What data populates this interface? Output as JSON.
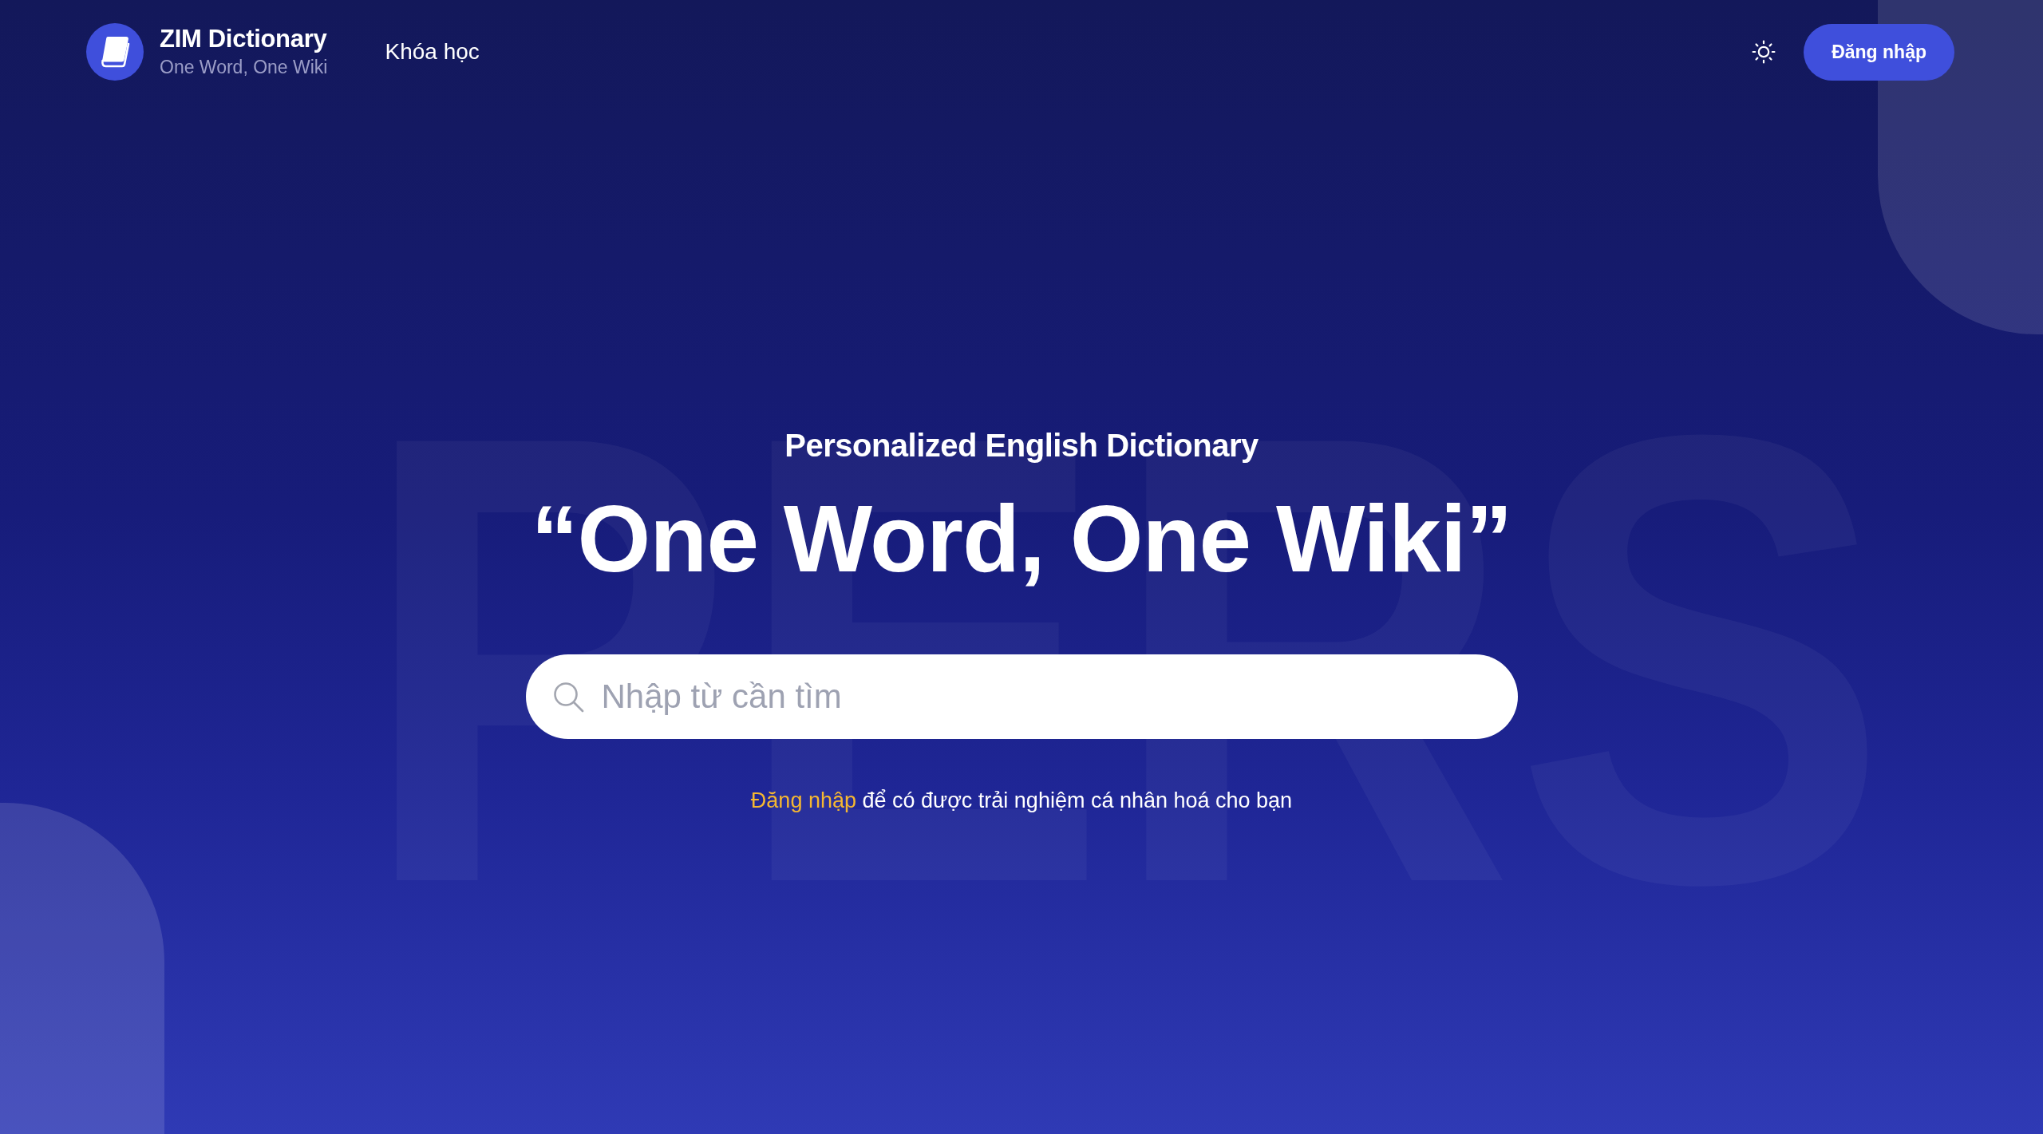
{
  "header": {
    "logo": {
      "title": "ZIM Dictionary",
      "tagline": "One Word, One Wiki"
    },
    "nav": [
      {
        "label": "Khóa học"
      }
    ],
    "login_button": "Đăng nhập"
  },
  "background_word": "PERS",
  "hero": {
    "subtitle": "Personalized English Dictionary",
    "headline": "“One Word, One Wiki”",
    "search": {
      "placeholder": "Nhập từ cần tìm"
    },
    "login_prompt": {
      "link": "Đăng nhập",
      "text": "để có được trải nghiệm cá nhân hoá cho bạn"
    }
  }
}
